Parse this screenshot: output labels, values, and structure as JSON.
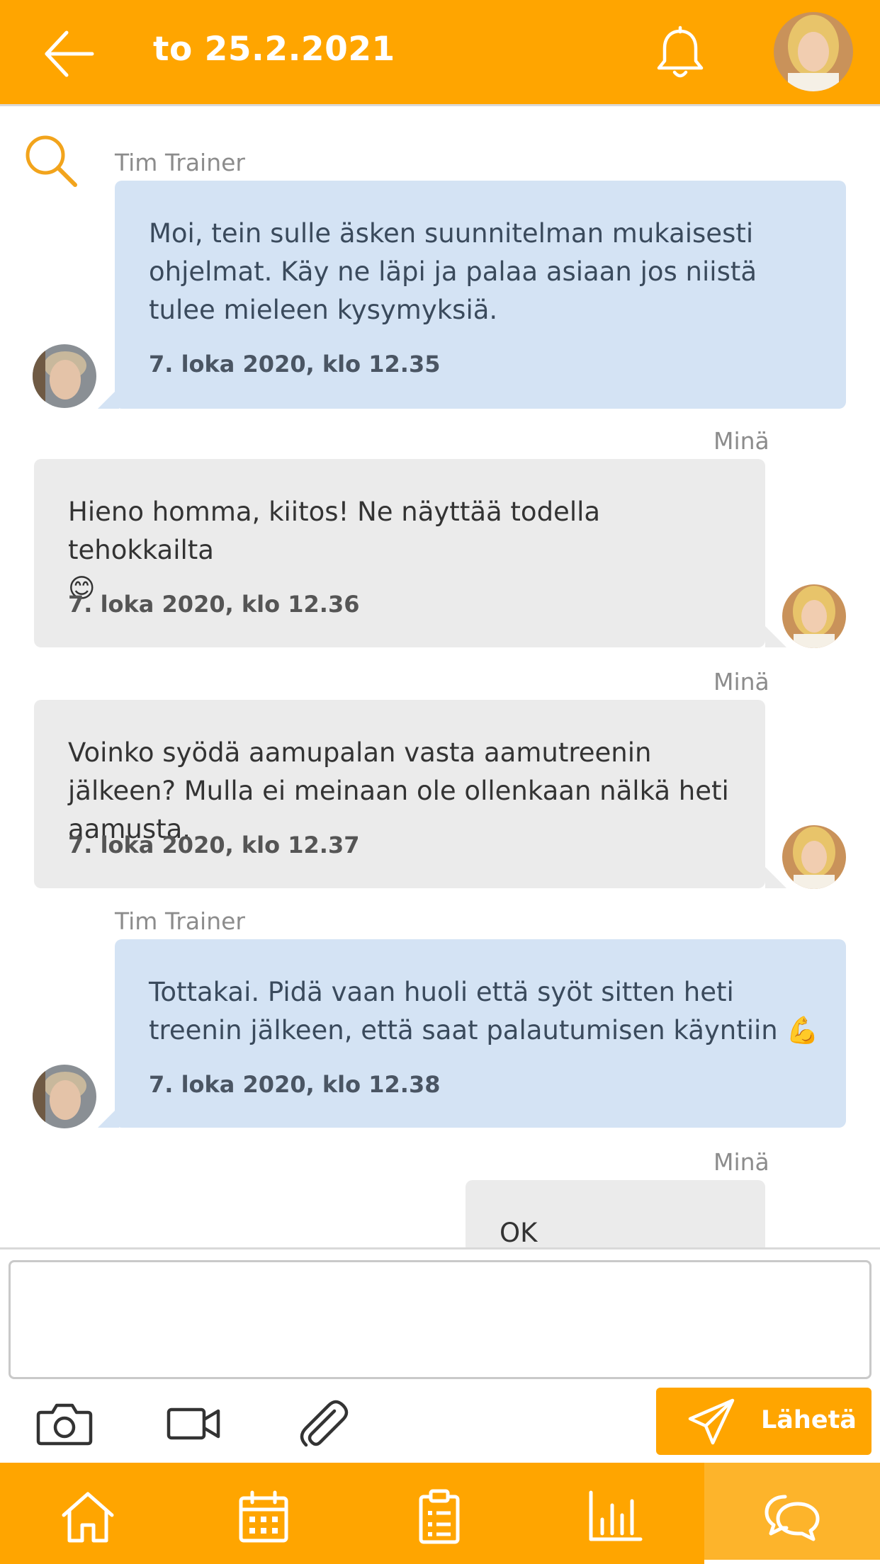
{
  "header": {
    "title": "to 25.2.2021",
    "back_icon": "arrow-left-icon",
    "bell_icon": "bell-icon"
  },
  "messages": [
    {
      "sender": "Tim Trainer",
      "text": "Moi, tein sulle äsken suunnitelman mukaisesti ohjelmat. Käy ne läpi ja palaa asiaan jos niistä tulee mieleen kysymyksiä.",
      "timestamp": "7. loka 2020, klo 12.35"
    },
    {
      "sender": "Minä",
      "text": "Hieno homma, kiitos! Ne näyttää todella tehokkailta",
      "emoji": "😊",
      "timestamp": "7. loka 2020, klo 12.36"
    },
    {
      "sender": "Minä",
      "text": "Voinko syödä aamupalan vasta aamutreenin jälkeen? Mulla ei meinaan ole ollenkaan nälkä heti aamusta.",
      "timestamp": "7. loka 2020, klo 12.37"
    },
    {
      "sender": "Tim Trainer",
      "text": "Tottakai. Pidä vaan huoli että syöt sitten heti treenin jälkeen, että saat palautumisen käyntiin",
      "emoji": "💪",
      "timestamp": "7. loka 2020, klo 12.38"
    },
    {
      "sender": "Minä",
      "text": "OK"
    }
  ],
  "composer": {
    "placeholder": "",
    "value": "",
    "send_label": "Lähetä",
    "tools": [
      "camera-icon",
      "video-icon",
      "paperclip-icon"
    ]
  },
  "nav": {
    "items": [
      "home-icon",
      "calendar-icon",
      "clipboard-list-icon",
      "bar-chart-icon",
      "chat-icon"
    ],
    "active": "chat-icon"
  },
  "colors": {
    "brand": "#FFA500",
    "trainer_bubble": "#D4E3F4",
    "my_bubble": "#EBEBEB"
  }
}
